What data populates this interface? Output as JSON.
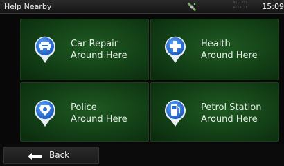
{
  "statusbar": {
    "title": "Help Nearby",
    "speed_text": "NIL PTS ATTA TF",
    "time": "15:09",
    "gps_icon": "satellite-icon"
  },
  "tiles": [
    {
      "icon": "car-repair-icon",
      "line1": "Car Repair",
      "line2": "Around Here"
    },
    {
      "icon": "health-cross-icon",
      "line1": "Health",
      "line2": "Around Here"
    },
    {
      "icon": "police-badge-icon",
      "line1": "Police",
      "line2": "Around Here"
    },
    {
      "icon": "fuel-pump-icon",
      "line1": "Petrol Station",
      "line2": "Around Here"
    }
  ],
  "bottombar": {
    "back_label": "Back",
    "back_icon": "arrow-left-icon"
  },
  "colors": {
    "tile_green": "#1f5a22",
    "pin_blue": "#1f6fd1",
    "text": "#e8f0e8"
  }
}
